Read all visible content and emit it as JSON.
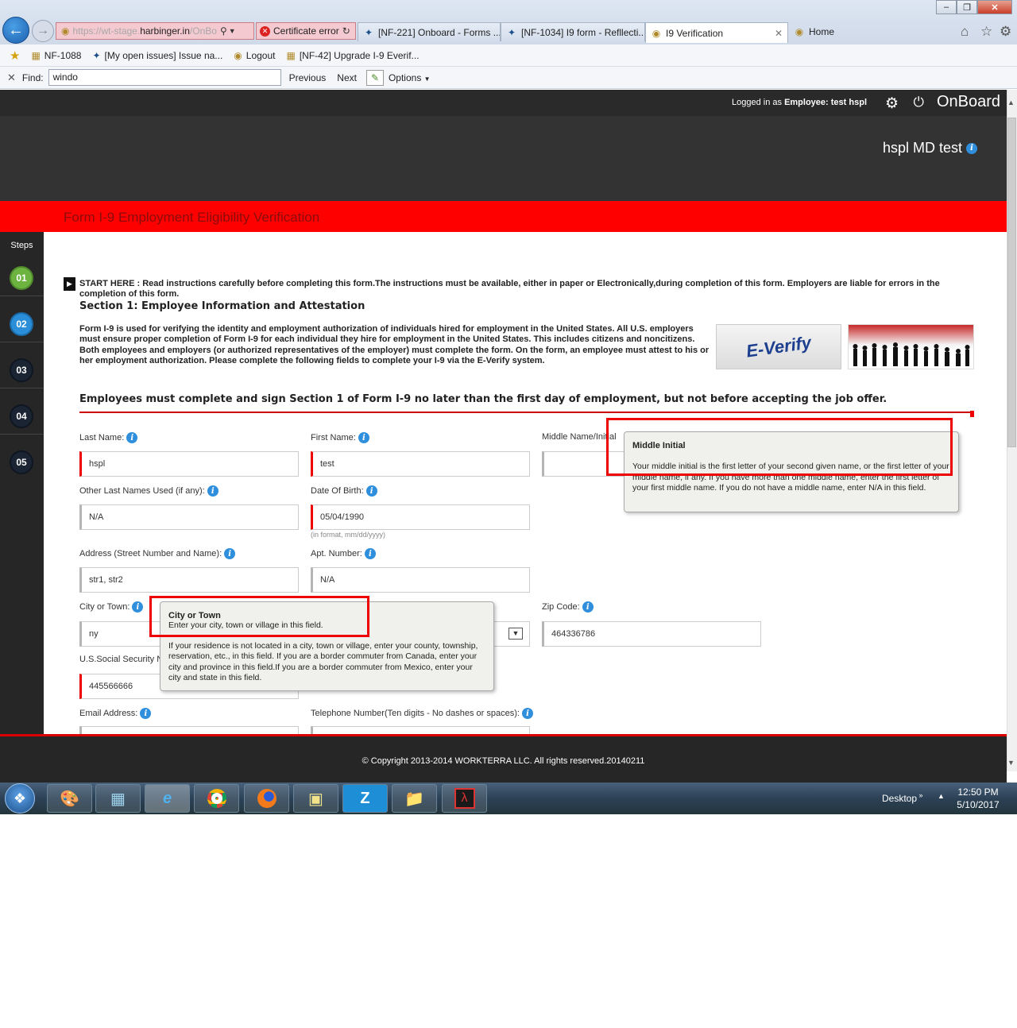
{
  "browser": {
    "address_host": "https://wt-stage.harbinger.in/OnBo",
    "address_prefix": "https://wt-stage.",
    "address_domain": "harbinger.in",
    "address_suffix": "/OnBo",
    "cert_error": "Certificate error",
    "tabs": [
      "[NF-221] Onboard - Forms ...",
      "[NF-1034] I9 form - Refllecti...",
      "I9 Verification",
      "Home"
    ],
    "favorites": [
      "NF-1088",
      "[My open issues] Issue na...",
      "Logout",
      "[NF-42] Upgrade I-9 Everif..."
    ],
    "find_label": "Find:",
    "find_value": "windo",
    "find_previous": "Previous",
    "find_next": "Next",
    "find_options": "Options"
  },
  "header": {
    "logged_prefix": "Logged in as",
    "logged_role": "Employee:",
    "logged_user": "test hspl",
    "brand": "OnBoard",
    "company": "hspl MD test"
  },
  "form_title": "Form I-9 Employment Eligibility Verification",
  "steps": {
    "label": "Steps",
    "items": [
      "01",
      "02",
      "03",
      "04",
      "05"
    ]
  },
  "content": {
    "start_here": "START HERE : Read instructions carefully before completing this form.The instructions must be available, either in paper or Electronically,during completion of this form. Employers are liable for errors in the completion of this form.",
    "section_title": "Section 1: Employee Information and Attestation",
    "intro": "Form I-9 is used for verifying the identity and employment authorization of individuals hired for employment in the United States. All U.S. employers must ensure proper completion of Form I-9 for each individual they hire for employment in the United States. This includes citizens and noncitizens. Both employees and employers (or authorized representatives of the employer) must complete the form. On the form, an employee must attest to his or her employment authorization. Please complete the following fields to complete your I-9 via the E-Verify system.",
    "everify_logo": "E-Verify",
    "notice": "Employees must complete and sign Section 1 of Form I-9 no later than the first day of employment, but  not before accepting the job offer."
  },
  "fields": {
    "last_name": {
      "label": "Last Name:",
      "value": "hspl"
    },
    "first_name": {
      "label": "First Name:",
      "value": "test"
    },
    "middle_name": {
      "label": "Middle Name/Initial",
      "value": ""
    },
    "other_last": {
      "label": "Other Last Names Used (if any):",
      "value": "N/A"
    },
    "dob": {
      "label": "Date Of Birth:",
      "value": "05/04/1990",
      "hint": "(in format, mm/dd/yyyy)"
    },
    "address": {
      "label": "Address (Street Number and Name):",
      "value": "str1, str2"
    },
    "apt": {
      "label": "Apt. Number:",
      "value": "N/A"
    },
    "city": {
      "label": "City or Town:",
      "value": "ny"
    },
    "zip": {
      "label": "Zip Code:",
      "value": "464336786"
    },
    "ssn": {
      "label": "U.S.Social Security N",
      "value": "445566666"
    },
    "email": {
      "label": "Email Address:"
    },
    "phone": {
      "label": "Telephone Number(Ten digits - No dashes or spaces):"
    }
  },
  "tooltips": {
    "middle": {
      "title": "Middle Initial",
      "body": "Your middle initial is the first letter of your second given name, or the first letter of your middle name, if any. If you have more than one middle name, enter the first letter of your first middle name. If you do not have a middle name, enter N/A in this field."
    },
    "city": {
      "title": "City or Town",
      "line1": "Enter your city, town or village in this field.",
      "body": "If your residence is not located in a city, town or village, enter your county, township, reservation, etc., in this field. If you are a border commuter from Canada, enter your city and province in this field.If you are a border commuter from Mexico, enter your city and state in this field."
    }
  },
  "footer": "© Copyright 2013-2014 WORKTERRA LLC. All rights reserved.20140211",
  "taskbar": {
    "desktop": "Desktop",
    "time": "12:50 PM",
    "date": "5/10/2017"
  },
  "colors": {
    "accent_red": "#ff0000",
    "step_done": "#6cb33f",
    "step_current": "#2a8fd8"
  }
}
